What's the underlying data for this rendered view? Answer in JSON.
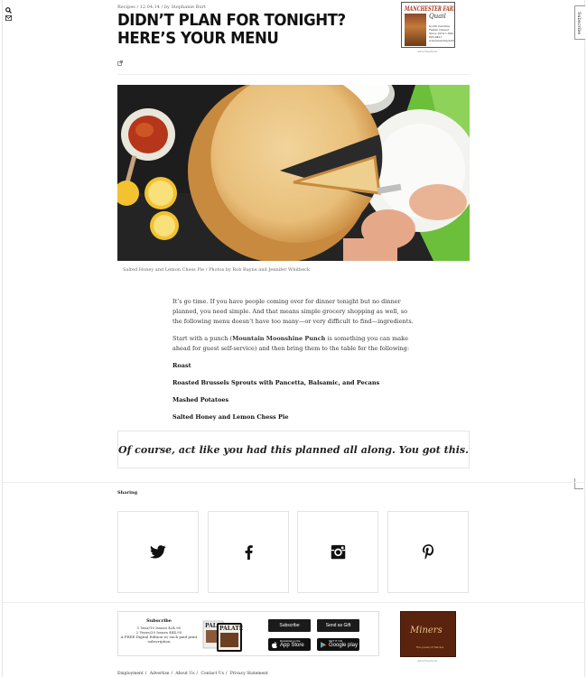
{
  "breadcrumb": "Recipes / 12.04.14 / by Stephanie Burt",
  "article": {
    "title_line1": "DIDN’T PLAN FOR TONIGHT?",
    "title_line2": "HERE’S YOUR MENU",
    "caption": "Salted Honey and Lemon Chess Pie / Photos by Rob Bayne and Jennifer Whitbeck",
    "para1": "It’s go time. If you have people coming over for dinner tonight but no dinner planned, you need simple. And that means simple grocery shopping as well, so the following menu doesn’t have too many—or very difficult to find—ingredients.",
    "para2_pre": "Start with a punch (",
    "para2_bold": "Mountain Moonshine Punch",
    "para2_post": " is something you can make ahead for guest self-service) and then bring them to the table for the following:",
    "menu": [
      "Roast",
      "Roasted Brussels Sprouts with Pancetta, Balsamic, and Pecans",
      "Mashed Potatoes",
      "Salted Honey and Lemon Chess Pie"
    ],
    "quote": "Of course, act like you had this planned all along. You got this."
  },
  "subscribe_tab": "Subscribe",
  "ad_top": {
    "brand": "MANCHESTER FARMS",
    "sub": "Quail",
    "text": "South Carolina Family Owned Since 1974 1-800-845-0421 www.manchesterfarms.com",
    "label": "Advertisement"
  },
  "sharing": {
    "label": "Sharing",
    "icons": [
      "twitter-icon",
      "facebook-icon",
      "instagram-icon",
      "pinterest-icon"
    ]
  },
  "subscribe_box": {
    "heading": "Subscribe",
    "line1": "1 Year/10 Issues $24.95",
    "line2": "2 Years/20 Issues $44.95",
    "line3": "A FREE Digital Edition w/ each paid print subscription",
    "mag_title": "PALATE",
    "subscribe_btn": "Subscribe",
    "gift_btn": "Send as Gift",
    "appstore_small": "Download on the",
    "appstore_big": "App Store",
    "googleplay_small": "GET IT ON",
    "googleplay_big": "Google play"
  },
  "ad_bottom": {
    "logo": "Miners",
    "fine": "Fine Jewelry & Watches",
    "label": "Advertisement"
  },
  "footer": [
    "Employment",
    "Advertise",
    "About Us",
    "Contact Us",
    "Privacy Statement"
  ]
}
